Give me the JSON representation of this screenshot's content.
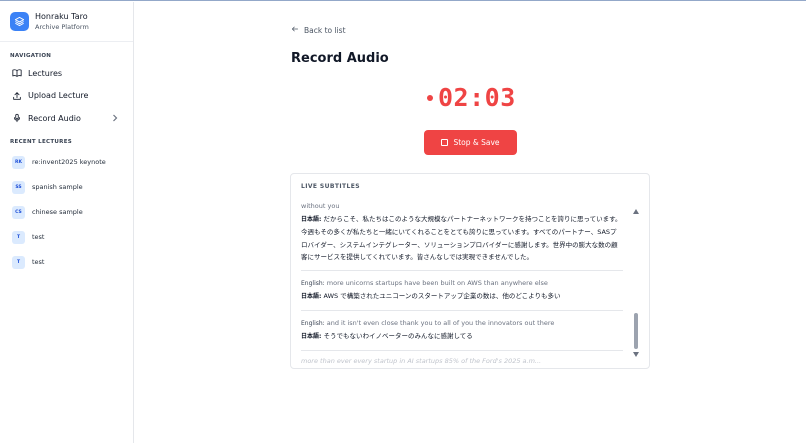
{
  "brand": {
    "name": "Honraku Taro",
    "subtitle": "Archive Platform",
    "logo_icon": "layers-icon",
    "accent": "#3b82f6"
  },
  "nav": {
    "title": "NAVIGATION",
    "items": [
      {
        "label": "Lectures",
        "icon": "book-icon"
      },
      {
        "label": "Upload Lecture",
        "icon": "upload-icon"
      },
      {
        "label": "Record Audio",
        "icon": "microphone-icon"
      }
    ]
  },
  "recent": {
    "title": "RECENT LECTURES",
    "items": [
      {
        "badge": "RK",
        "label": "re:invent2025 keynote"
      },
      {
        "badge": "SS",
        "label": "spanish sample"
      },
      {
        "badge": "CS",
        "label": "chinese sample"
      },
      {
        "badge": "T",
        "label": "test"
      },
      {
        "badge": "T",
        "label": "test"
      }
    ]
  },
  "main": {
    "back_label": "Back to list",
    "title": "Record Audio",
    "timer": "02:03",
    "stop_label": "Stop & Save",
    "record_color": "#ef4444"
  },
  "subtitles": {
    "title": "LIVE SUBTITLES",
    "partial_top": "without you",
    "entries": [
      {
        "en_label": "",
        "en": "",
        "ja_label": "日本語:",
        "ja": "だからこそ、私たちはこのような大規模なパートナーネットワークを持つことを誇りに思っています。今週もその多くが私たちと一緒にいてくれることをとても誇りに思っています。すべてのパートナー、SASプロバイダー、システムインテグレーター、ソリューションプロバイダーに感謝します。世界中の膨大な数の顧客にサービスを提供してくれています。皆さんなしでは実現できませんでした。"
      },
      {
        "en_label": "English:",
        "en": "more unicorns startups have been built on AWS than anywhere else",
        "ja_label": "日本語:",
        "ja": "AWS で構築されたユニコーンのスタートアップ企業の数は、他のどこよりも多い"
      },
      {
        "en_label": "English:",
        "en": "and it isn't even close thank you to all of you the innovators out there",
        "ja_label": "日本語:",
        "ja": "そうでもないわイノベーターのみんなに感謝してる"
      }
    ],
    "pending": "more than ever every startup in AI startups 85% of the Ford's 2025 a.m..."
  }
}
